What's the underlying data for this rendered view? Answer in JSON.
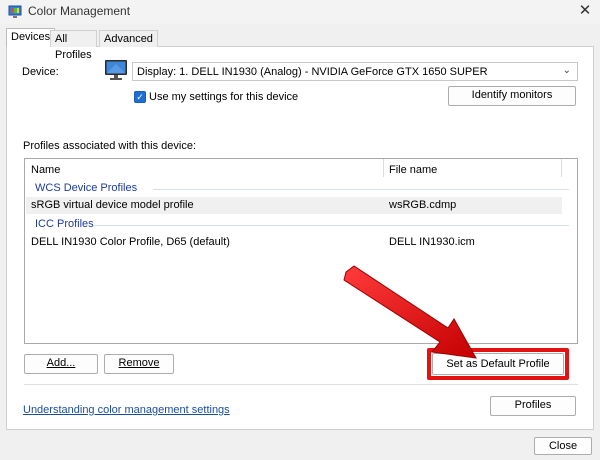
{
  "window": {
    "title": "Color Management",
    "close_glyph": "✕"
  },
  "tabs": [
    {
      "label": "Devices",
      "active": true
    },
    {
      "label": "All Profiles",
      "active": false
    },
    {
      "label": "Advanced",
      "active": false
    }
  ],
  "device": {
    "label": "Device:",
    "selected": "Display: 1. DELL IN1930 (Analog) - NVIDIA GeForce GTX 1650 SUPER",
    "use_my_settings_label": "Use my settings for this device",
    "use_my_settings_checked": true,
    "identify_button": "Identify monitors"
  },
  "profiles": {
    "section_label": "Profiles associated with this device:",
    "columns": [
      "Name",
      "File name"
    ],
    "groups": [
      {
        "name": "WCS Device Profiles",
        "rows": [
          {
            "name": "sRGB virtual device model profile",
            "file": "wsRGB.cdmp"
          }
        ]
      },
      {
        "name": "ICC Profiles",
        "rows": [
          {
            "name": "DELL IN1930 Color Profile, D65 (default)",
            "file": "DELL IN1930.icm"
          }
        ]
      }
    ],
    "add_button": "Add...",
    "remove_button": "Remove",
    "set_default_button": "Set as Default Profile"
  },
  "footer": {
    "link": "Understanding color management settings",
    "profiles_button": "Profiles",
    "close_button": "Close"
  },
  "colors": {
    "highlight": "#e51212",
    "arrow": "#e51212",
    "link": "#1a4e9c",
    "checkbox": "#1f6fd0"
  }
}
